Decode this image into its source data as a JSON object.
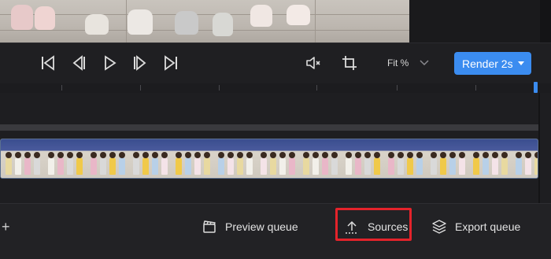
{
  "playback": {
    "skip_back_icon": "skip-to-start-icon",
    "frame_back_icon": "step-back-icon",
    "play_icon": "play-icon",
    "frame_forward_icon": "step-forward-icon",
    "skip_forward_icon": "skip-to-end-icon"
  },
  "toolbar": {
    "mute_icon": "speaker-muted-icon",
    "crop_icon": "crop-icon",
    "fit_label": "Fit %",
    "render_label": "Render 2s"
  },
  "bottom": {
    "add_label": "+",
    "preview_queue_label": "Preview queue",
    "sources_label": "Sources",
    "export_queue_label": "Export queue"
  },
  "colors": {
    "accent": "#3b8cf0",
    "highlight": "#e4232b"
  }
}
